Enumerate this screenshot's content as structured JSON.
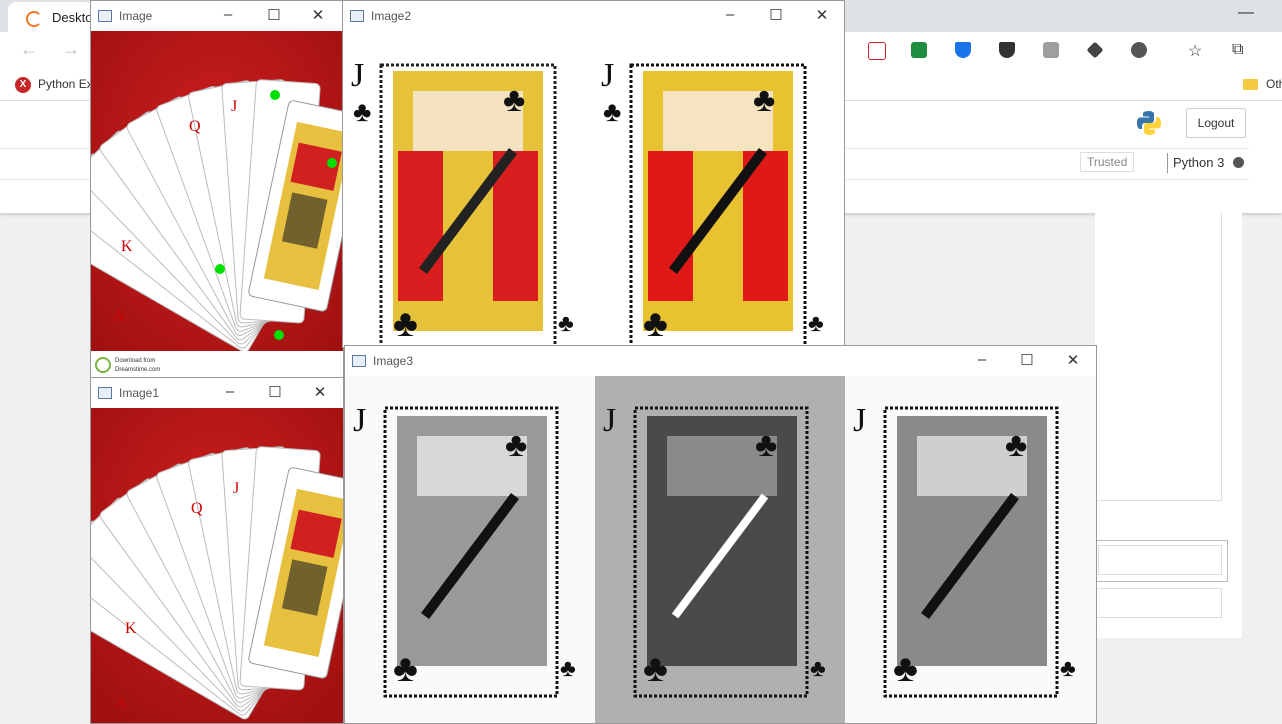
{
  "browser": {
    "tab_title": "Desktop",
    "bookmark_label": "Python Ex",
    "bookmark_icon_letter": "X",
    "bookmark_other": "Oth"
  },
  "jupyter": {
    "logout_label": "Logout",
    "trusted_label": "Trusted",
    "kernel_label": "Python 3"
  },
  "windows": {
    "image": {
      "title": "Image"
    },
    "image1": {
      "title": "Image1"
    },
    "image2": {
      "title": "Image2"
    },
    "image3": {
      "title": "Image3"
    }
  },
  "strip": {
    "line1": "Download from",
    "line2": "Dreamstime.com"
  },
  "cards": {
    "fan_ranks": [
      "A",
      "A",
      "A",
      "A",
      "K",
      "K",
      "K",
      "K",
      "Q",
      "Q",
      "Q",
      "Q",
      "J",
      "J",
      "J",
      "J"
    ],
    "jack_rank": "J"
  },
  "colors": {
    "felt": "#c41a1a",
    "corner_dot": "#00e000",
    "accent": "#f37726"
  }
}
